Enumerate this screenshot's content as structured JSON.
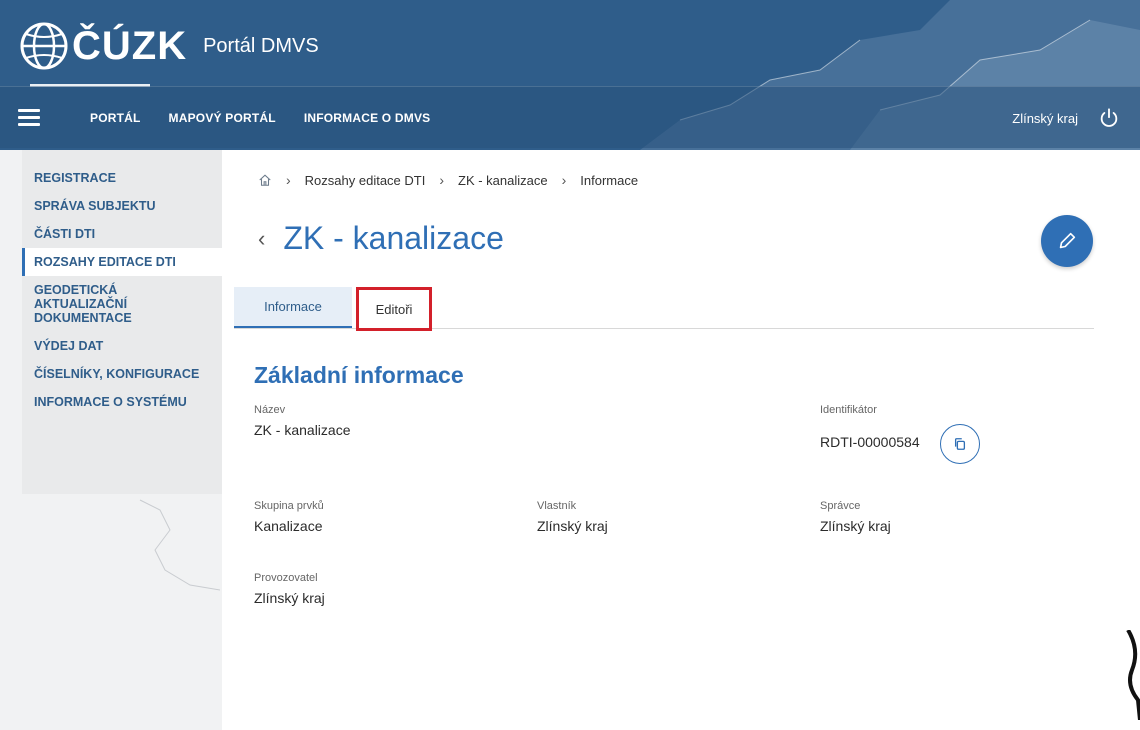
{
  "header": {
    "logo_text": "ČÚZK",
    "portal_title": "Portál DMVS",
    "nav": [
      "PORTÁL",
      "MAPOVÝ PORTÁL",
      "INFORMACE O DMVS"
    ],
    "region": "Zlínský kraj"
  },
  "sidebar": {
    "items": [
      {
        "label": "REGISTRACE"
      },
      {
        "label": "SPRÁVA SUBJEKTU"
      },
      {
        "label": "ČÁSTI DTI"
      },
      {
        "label": "ROZSAHY EDITACE DTI"
      },
      {
        "label": "GEODETICKÁ AKTUALIZAČNÍ DOKUMENTACE"
      },
      {
        "label": "VÝDEJ DAT"
      },
      {
        "label": "ČÍSELNÍKY, KONFIGURACE"
      },
      {
        "label": "INFORMACE O SYSTÉMU"
      }
    ],
    "active_index": 3
  },
  "breadcrumb": [
    "Rozsahy editace DTI",
    "ZK - kanalizace",
    "Informace"
  ],
  "page": {
    "title": "ZK - kanalizace",
    "tabs": [
      "Informace",
      "Editoři"
    ],
    "section_title": "Základní informace"
  },
  "fields": {
    "nazev": {
      "label": "Název",
      "value": "ZK - kanalizace"
    },
    "identifikator": {
      "label": "Identifikátor",
      "value": "RDTI-00000584"
    },
    "skupina": {
      "label": "Skupina prvků",
      "value": "Kanalizace"
    },
    "vlastnik": {
      "label": "Vlastník",
      "value": "Zlínský kraj"
    },
    "spravce": {
      "label": "Správce",
      "value": "Zlínský kraj"
    },
    "provozovatel": {
      "label": "Provozovatel",
      "value": "Zlínský kraj"
    }
  },
  "colors": {
    "header": "#2f5d8a",
    "accent": "#2f6fb5",
    "highlight": "#d3202a"
  }
}
